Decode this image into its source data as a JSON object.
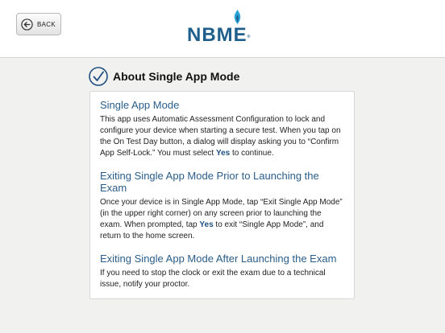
{
  "header": {
    "back_label": "BACK",
    "logo_text": "NBME",
    "logo_reg": "®",
    "brand_color": "#1f5f8b",
    "flame_color": "#2aa3d8"
  },
  "page": {
    "title": "About Single App Mode"
  },
  "sections": [
    {
      "heading": "Single App Mode",
      "body_before": "This app uses Automatic Assessment Configuration to lock and configure your device when starting a secure test. When you tap on the On Test Day button, a dialog will display asking you to “Confirm App Self-Lock.” You must select ",
      "emphasis": "Yes",
      "body_after": " to continue."
    },
    {
      "heading": "Exiting Single App Mode Prior to Launching the Exam",
      "body_before": "Once your device is in Single App Mode, tap “Exit Single App Mode” (in the upper right corner) on any screen prior to launching the exam. When prompted, tap ",
      "emphasis": "Yes",
      "body_after": " to exit “Single App Mode”, and return to the home screen."
    },
    {
      "heading": "Exiting Single App Mode After Launching the Exam",
      "body": "If you need to stop the clock or exit the exam due to a technical issue, notify your proctor."
    }
  ],
  "icons": {
    "back": "back-arrow-circle-icon",
    "title": "checkmark-circle-icon",
    "logo": "flame-icon"
  },
  "colors": {
    "heading": "#2a5d89",
    "emphasis": "#1f4f80",
    "page_background": "#f1f1ef"
  }
}
